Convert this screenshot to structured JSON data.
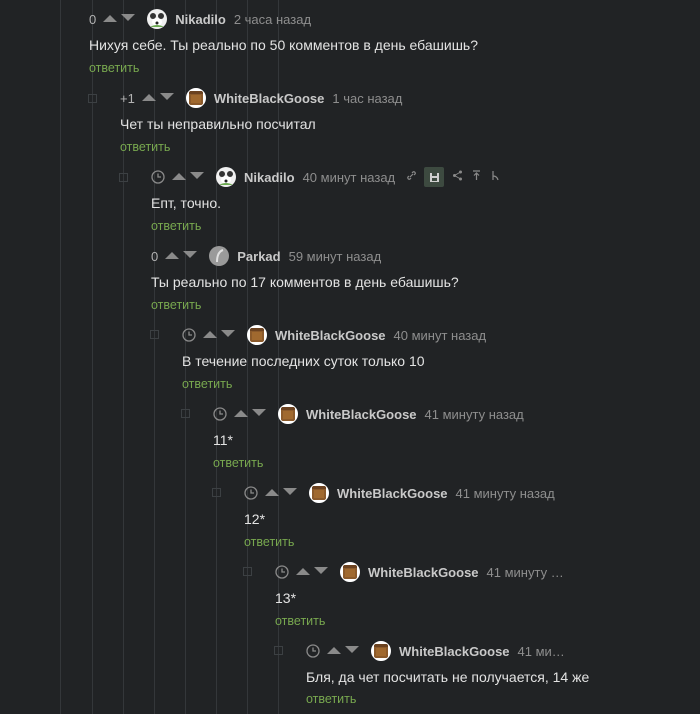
{
  "labels": {
    "reply": "ответить"
  },
  "colors": {
    "background": "#212325",
    "reply_link": "#78a84f",
    "text": "#e3e3e3",
    "meta": "#8e8e8e"
  },
  "comments": [
    {
      "rating": "0",
      "author": "Nikadilo",
      "time": "2 часа назад",
      "text": "Нихуя себе. Ты реально по 50 комментов в день ебашишь?",
      "avatar": "panda-avatar"
    },
    {
      "rating": "+1",
      "author": "WhiteBlackGoose",
      "time": "1 час назад",
      "text": "Чет ты неправильно посчитал",
      "avatar": "box-avatar"
    },
    {
      "rating": "",
      "author": "Nikadilo",
      "time": "40 минут назад",
      "text": "Епт, точно.",
      "avatar": "panda-avatar",
      "tools": [
        "link-icon",
        "save-icon",
        "share-icon",
        "to-top-icon",
        "branch-icon"
      ]
    },
    {
      "rating": "0",
      "author": "Parkad",
      "time": "59 минут назад",
      "text": "Ты реально по 17 комментов в день ебашишь?",
      "avatar": "gray-avatar"
    },
    {
      "rating": "",
      "author": "WhiteBlackGoose",
      "time": "40 минут назад",
      "text": "В течение последних суток только 10",
      "avatar": "box-avatar"
    },
    {
      "rating": "",
      "author": "WhiteBlackGoose",
      "time": "41 минуту назад",
      "text": "11*",
      "avatar": "box-avatar"
    },
    {
      "rating": "",
      "author": "WhiteBlackGoose",
      "time": "41 минуту назад",
      "text": "12*",
      "avatar": "box-avatar"
    },
    {
      "rating": "",
      "author": "WhiteBlackGoose",
      "time": "41 минуту …",
      "text": "13*",
      "avatar": "box-avatar"
    },
    {
      "rating": "",
      "author": "WhiteBlackGoose",
      "time": "41 ми…",
      "text": "Бля, да чет посчитать не получается, 14 же",
      "avatar": "box-avatar"
    }
  ]
}
